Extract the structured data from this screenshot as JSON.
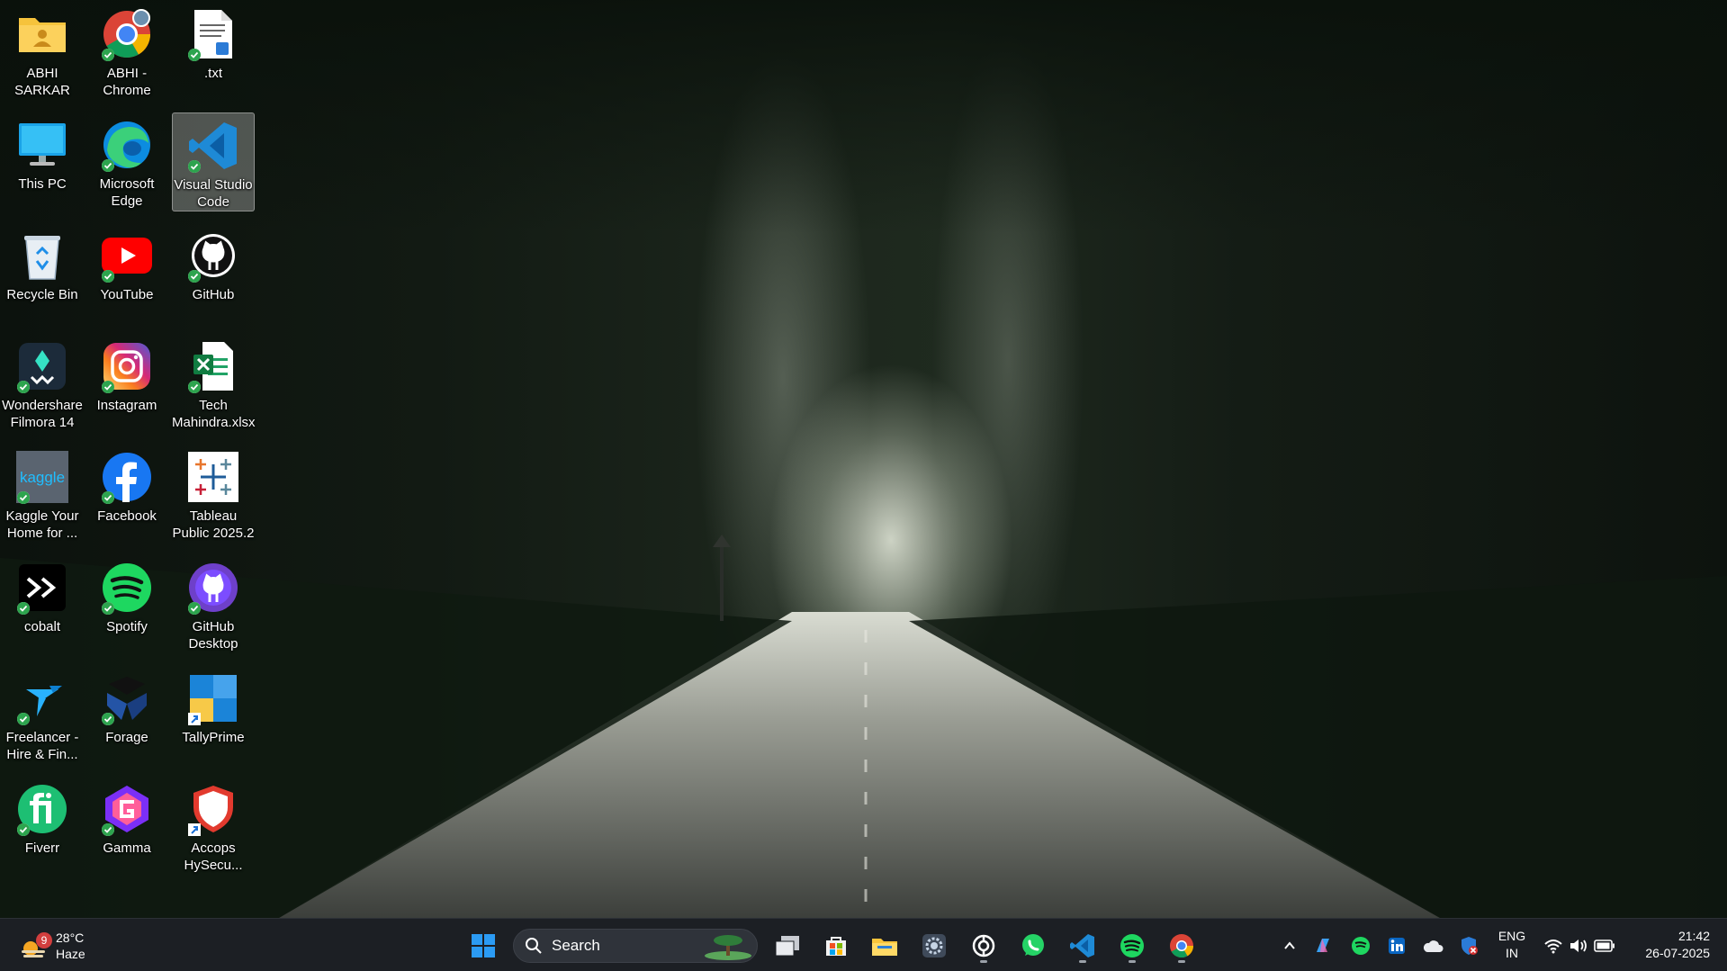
{
  "desktop_icons": [
    {
      "name": "folder-icon",
      "label": "ABHI\nSARKAR",
      "col": 0,
      "row": 0,
      "badge": "none"
    },
    {
      "name": "chrome-icon",
      "label": "ABHI -\nChrome",
      "col": 1,
      "row": 0,
      "badge": "sync"
    },
    {
      "name": "txt-file-icon",
      "label": ".txt",
      "col": 2,
      "row": 0,
      "badge": "sync"
    },
    {
      "name": "this-pc-icon",
      "label": "This PC",
      "col": 0,
      "row": 1,
      "badge": "none"
    },
    {
      "name": "edge-icon",
      "label": "Microsoft\nEdge",
      "col": 1,
      "row": 1,
      "badge": "sync"
    },
    {
      "name": "vscode-icon",
      "label": "Visual Studio\nCode",
      "col": 2,
      "row": 1,
      "badge": "sync",
      "selected": true
    },
    {
      "name": "recycle-bin-icon",
      "label": "Recycle Bin",
      "col": 0,
      "row": 2,
      "badge": "none"
    },
    {
      "name": "youtube-icon",
      "label": "YouTube",
      "col": 1,
      "row": 2,
      "badge": "sync"
    },
    {
      "name": "github-icon",
      "label": "GitHub",
      "col": 2,
      "row": 2,
      "badge": "sync"
    },
    {
      "name": "filmora-icon",
      "label": "Wondershare\nFilmora 14",
      "col": 0,
      "row": 3,
      "badge": "sync"
    },
    {
      "name": "instagram-icon",
      "label": "Instagram",
      "col": 1,
      "row": 3,
      "badge": "sync"
    },
    {
      "name": "excel-file-icon",
      "label": "Tech\nMahindra.xlsx",
      "col": 2,
      "row": 3,
      "badge": "sync"
    },
    {
      "name": "kaggle-icon",
      "label": "Kaggle  Your\nHome for ...",
      "col": 0,
      "row": 4,
      "badge": "sync"
    },
    {
      "name": "facebook-icon",
      "label": "Facebook",
      "col": 1,
      "row": 4,
      "badge": "sync"
    },
    {
      "name": "tableau-icon",
      "label": "Tableau\nPublic 2025.2",
      "col": 2,
      "row": 4,
      "badge": "none"
    },
    {
      "name": "cobalt-icon",
      "label": "cobalt",
      "col": 0,
      "row": 5,
      "badge": "sync"
    },
    {
      "name": "spotify-icon",
      "label": "Spotify",
      "col": 1,
      "row": 5,
      "badge": "sync"
    },
    {
      "name": "github-desktop-icon",
      "label": "GitHub\nDesktop",
      "col": 2,
      "row": 5,
      "badge": "sync"
    },
    {
      "name": "freelancer-icon",
      "label": "Freelancer -\nHire & Fin...",
      "col": 0,
      "row": 6,
      "badge": "sync"
    },
    {
      "name": "forage-icon",
      "label": "Forage",
      "col": 1,
      "row": 6,
      "badge": "sync"
    },
    {
      "name": "tallyprime-icon",
      "label": "TallyPrime",
      "col": 2,
      "row": 6,
      "badge": "shortcut"
    },
    {
      "name": "fiverr-icon",
      "label": "Fiverr",
      "col": 0,
      "row": 7,
      "badge": "sync"
    },
    {
      "name": "gamma-icon",
      "label": "Gamma",
      "col": 1,
      "row": 7,
      "badge": "sync"
    },
    {
      "name": "accops-icon",
      "label": "Accops\nHySecu...",
      "col": 2,
      "row": 7,
      "badge": "shortcut"
    }
  ],
  "taskbar": {
    "weather": {
      "temp": "28°C",
      "condition": "Haze",
      "badge": "9"
    },
    "search": {
      "placeholder": "Search"
    },
    "pinned": [
      {
        "name": "start-button",
        "running": false
      },
      {
        "name": "task-view-button",
        "running": false
      },
      {
        "name": "microsoft-store-button",
        "running": false
      },
      {
        "name": "file-explorer-button",
        "running": false
      },
      {
        "name": "settings-button",
        "running": false
      },
      {
        "name": "chatgpt-button",
        "running": true
      },
      {
        "name": "whatsapp-button",
        "running": false
      },
      {
        "name": "vscode-taskbar-button",
        "running": true
      },
      {
        "name": "spotify-taskbar-button",
        "running": true
      },
      {
        "name": "chrome-taskbar-button",
        "running": true
      }
    ],
    "tray": {
      "lang_top": "ENG",
      "lang_bottom": "IN",
      "time": "21:42",
      "date": "26-07-2025"
    }
  },
  "colors": {
    "taskbar": "#1c1f24",
    "accent": "#0078d4"
  }
}
